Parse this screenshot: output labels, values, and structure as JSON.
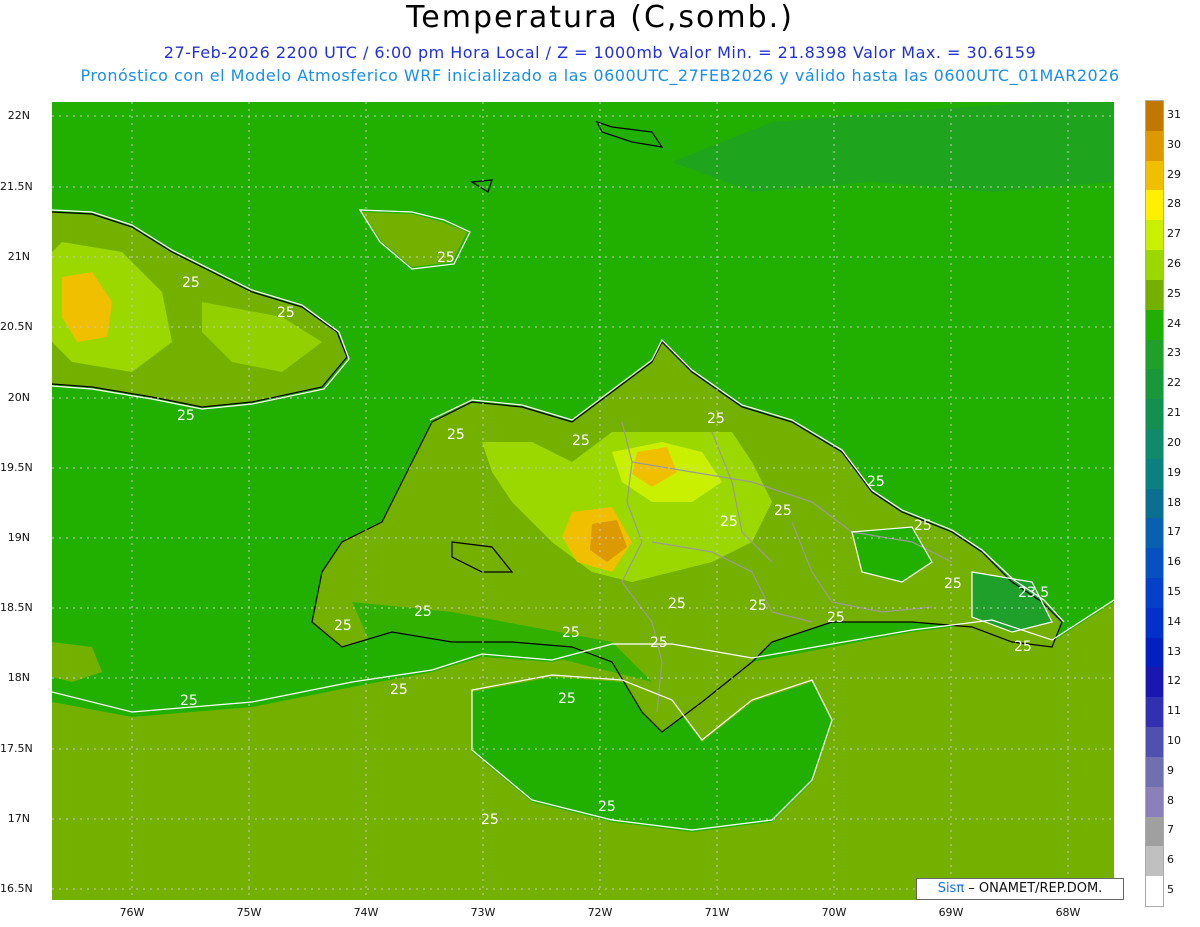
{
  "header": {
    "title": "Temperatura (C,somb.)",
    "line1": "27-Feb-2026  2200 UTC / 6:00 pm Hora Local / Z = 1000mb   Valor Min. = 21.8398  Valor Max. = 30.6159",
    "line2": "Pronóstico con el Modelo Atmosferico WRF inicializado a las 0600UTC_27FEB2026 y válido hasta las  0600UTC_01MAR2026"
  },
  "axes": {
    "lat_labels": [
      "22N",
      "21.5N",
      "21N",
      "20.5N",
      "20N",
      "19.5N",
      "19N",
      "18.5N",
      "18N",
      "17.5N",
      "17N",
      "16.5N"
    ],
    "lon_labels": [
      "76W",
      "75W",
      "74W",
      "73W",
      "72W",
      "71W",
      "70W",
      "69W",
      "68W"
    ]
  },
  "colorbar": {
    "labels": [
      "31",
      "30",
      "29",
      "28",
      "27",
      "26",
      "25",
      "24",
      "23",
      "22",
      "21",
      "20",
      "19",
      "18",
      "17",
      "16",
      "15",
      "14",
      "13",
      "12",
      "11",
      "10",
      "9",
      "8",
      "7",
      "6",
      "5"
    ],
    "colors": [
      "#c07800",
      "#dc9a00",
      "#f0c000",
      "#fff000",
      "#c8f000",
      "#9ad800",
      "#74b000",
      "#22b000",
      "#1ea02a",
      "#189838",
      "#139050",
      "#108a68",
      "#0c8080",
      "#0a7090",
      "#0860b0",
      "#0650c0",
      "#0440c8",
      "#0330c8",
      "#0220c0",
      "#1818b0",
      "#3030b0",
      "#5050b0",
      "#7070b0",
      "#8c80b8",
      "#a0a0a0",
      "#c0c0c0",
      "#ffffff"
    ]
  },
  "contours": {
    "labels": [
      "25",
      "25",
      "25",
      "25",
      "25",
      "25",
      "25",
      "25",
      "25",
      "25",
      "25",
      "25",
      "25",
      "25",
      "25",
      "25",
      "25",
      "25",
      "25",
      "25",
      "23.5",
      "25",
      "25",
      "25",
      "25",
      "25"
    ]
  },
  "credit": {
    "sis": "Sisπ",
    "org": " – ONAMET/REP.DOM."
  }
}
